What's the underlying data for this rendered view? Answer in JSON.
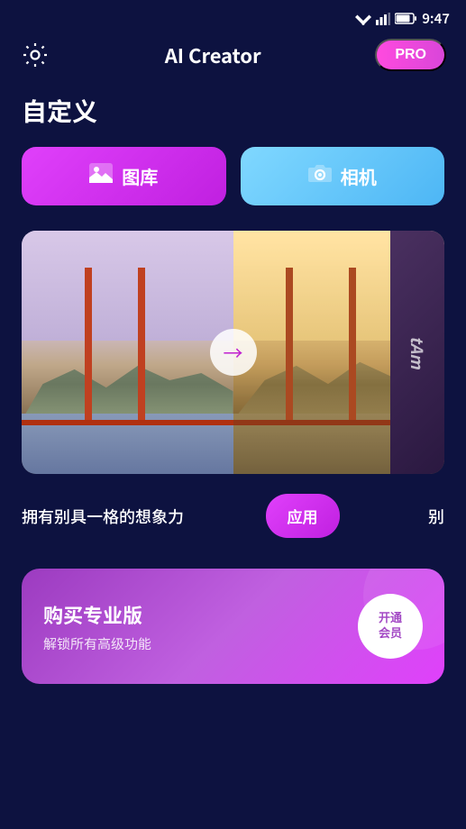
{
  "statusBar": {
    "time": "9:47"
  },
  "header": {
    "title": "AI Creator",
    "proBadge": "PRO"
  },
  "page": {
    "sectionTitle": "自定义"
  },
  "buttons": {
    "gallery": "图库",
    "camera": "相机"
  },
  "showcase": {
    "arrowIcon": "→",
    "watermarkText": "tAm"
  },
  "caption": {
    "text": "拥有别具一格的想象力",
    "applyBtn": "应用",
    "overflow": "别"
  },
  "proCard": {
    "title": "购买专业版",
    "subtitle": "解锁所有高级功能",
    "activateBtn": "开通\n会员"
  }
}
